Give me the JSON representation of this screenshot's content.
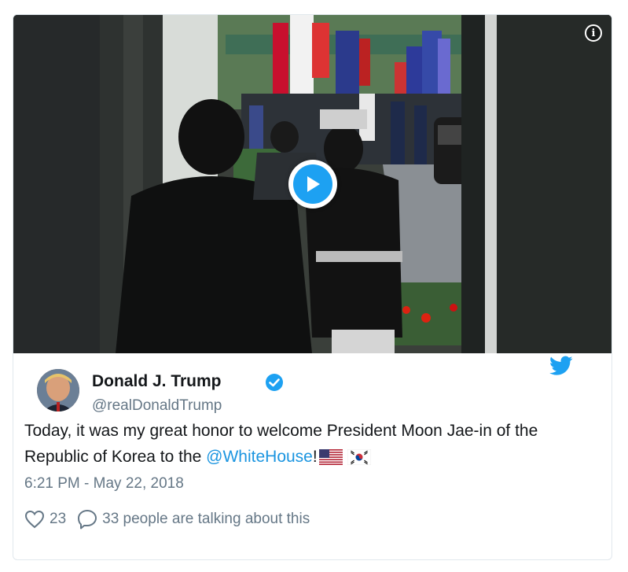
{
  "media": {
    "info_icon": "info-icon",
    "play_icon": "play-icon"
  },
  "author": {
    "name": "Donald J. Trump",
    "handle": "@realDonaldTrump",
    "verified_icon": "verified-badge-icon",
    "avatar_icon": "avatar"
  },
  "brand": {
    "icon": "twitter-bird-icon",
    "color": "#1da1f2"
  },
  "tweet": {
    "text_before": "Today, it was my great honor to welcome President Moon Jae-in of the Republic of Korea to the ",
    "mention": "@WhiteHouse",
    "text_after": "!",
    "emojis": [
      "us-flag-icon",
      "south-korea-flag-icon"
    ]
  },
  "timestamp": "6:21 PM - May 22, 2018",
  "actions": {
    "likes": "23",
    "conversation": "33 people are talking about this",
    "like_icon": "heart-icon",
    "reply_icon": "speech-bubble-icon"
  },
  "colors": {
    "link": "#1b95e0",
    "secondary_text": "#657786",
    "border": "#e1e8ed"
  }
}
